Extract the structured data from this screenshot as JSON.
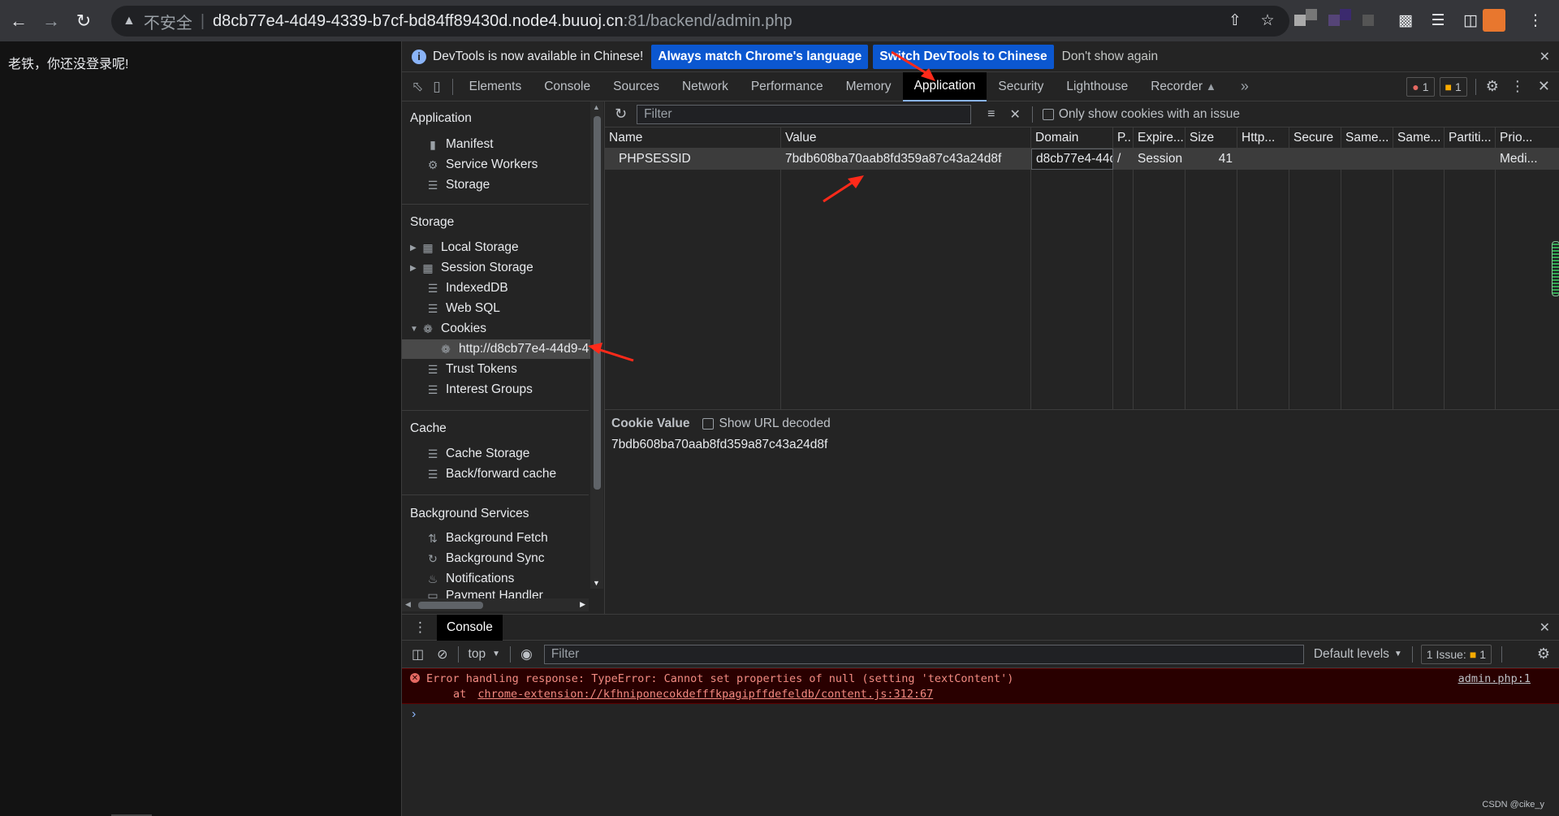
{
  "browser": {
    "insecure_label": "不安全",
    "url_host": "d8cb77e4-4d49-4339-b7cf-bd84ff89430d.node4.buuoj.cn",
    "url_rest": ":81/backend/admin.php"
  },
  "page": {
    "message": "老铁，你还没登录呢!"
  },
  "infobar": {
    "text": "DevTools is now available in Chinese!",
    "match_button": "Always match Chrome's language",
    "switch_button": "Switch DevTools to Chinese",
    "dismiss_button": "Don't show again"
  },
  "tabs": {
    "elements": "Elements",
    "console": "Console",
    "sources": "Sources",
    "network": "Network",
    "performance": "Performance",
    "memory": "Memory",
    "application": "Application",
    "security": "Security",
    "lighthouse": "Lighthouse",
    "recorder": "Recorder",
    "errors_count": "1",
    "warnings_count": "1"
  },
  "sidebar": {
    "application_title": "Application",
    "manifest": "Manifest",
    "service_workers": "Service Workers",
    "storage": "Storage",
    "storage_title": "Storage",
    "local_storage": "Local Storage",
    "session_storage": "Session Storage",
    "indexeddb": "IndexedDB",
    "web_sql": "Web SQL",
    "cookies": "Cookies",
    "cookie_origin": "http://d8cb77e4-44d9-4",
    "trust_tokens": "Trust Tokens",
    "interest_groups": "Interest Groups",
    "cache_title": "Cache",
    "cache_storage": "Cache Storage",
    "bfcache": "Back/forward cache",
    "bg_title": "Background Services",
    "bg_fetch": "Background Fetch",
    "bg_sync": "Background Sync",
    "notifications": "Notifications",
    "payment_handler": "Payment Handler"
  },
  "cookies_panel": {
    "filter_placeholder": "Filter",
    "only_issues_label": "Only show cookies with an issue",
    "headers": [
      "Name",
      "Value",
      "Domain",
      "P..",
      "Expire...",
      "Size",
      "Http...",
      "Secure",
      "Same...",
      "Same...",
      "Partiti...",
      "Prio..."
    ],
    "row": {
      "name": "PHPSESSID",
      "value": "7bdb608ba70aab8fd359a87c43a24d8f",
      "domain": "d8cb77e4-44d",
      "path": "/",
      "expires": "Session",
      "size": "41",
      "priority": "Medi..."
    },
    "cookie_value_label": "Cookie Value",
    "show_decoded_label": "Show URL decoded",
    "cookie_value_text": "7bdb608ba70aab8fd359a87c43a24d8f"
  },
  "drawer": {
    "console_tab": "Console",
    "context": "top",
    "filter_placeholder": "Filter",
    "levels": "Default levels",
    "issues_label": "1 Issue:",
    "issues_count": "1",
    "error_line1": "Error handling response: TypeError: Cannot set properties of null (setting 'textContent')",
    "error_at": "at",
    "error_link": "chrome-extension://kfhniponecokdefffkpagipffdefeldb/content.js:312:67",
    "error_source": "admin.php:1",
    "prompt": "›"
  },
  "watermark": "CSDN @cike_y",
  "colors": {
    "accent_blue": "#0b57d0",
    "error_red": "#f28b82",
    "annotation_arrow": "#ff2a1a"
  }
}
